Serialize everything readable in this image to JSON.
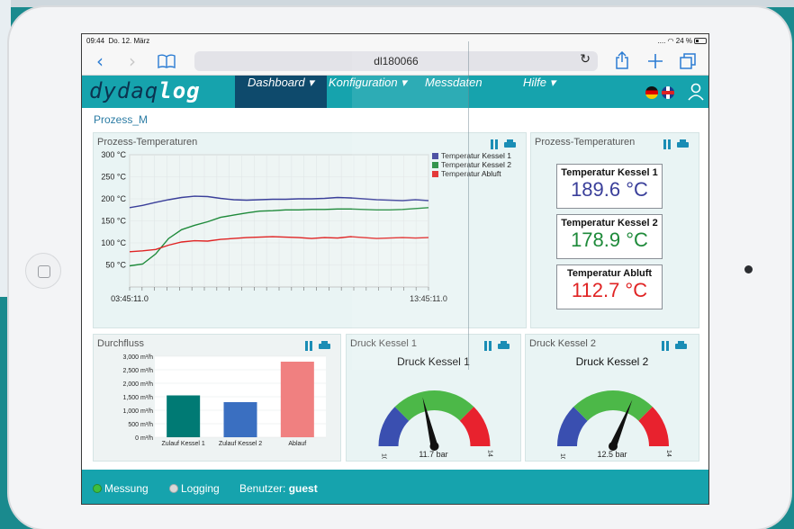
{
  "status": {
    "time": "09:44",
    "date": "Do. 12. März",
    "signal": "....",
    "battery": "24 %"
  },
  "browser": {
    "url": "dl180066",
    "icons": [
      "back-icon",
      "forward-icon",
      "bookmarks-icon",
      "reload-icon",
      "share-icon",
      "new-tab-icon",
      "tabs-icon"
    ]
  },
  "app": {
    "logo_plain": "dydaq",
    "logo_bold": "log",
    "nav": [
      {
        "label": "Dashboard ▾",
        "active": true
      },
      {
        "label": "Konfiguration ▾",
        "active": false
      },
      {
        "label": "Messdaten",
        "active": false
      },
      {
        "label": "Hilfe ▾",
        "active": false
      }
    ],
    "breadcrumb": "Prozess_M"
  },
  "panels": {
    "temps_chart_title": "Prozess-Temperaturen",
    "temps_tiles_title": "Prozess-Temperaturen",
    "flow_title": "Durchfluss",
    "gauge1_title": "Druck Kessel 1",
    "gauge2_title": "Druck Kessel 2"
  },
  "tiles": [
    {
      "label": "Temperatur Kessel 1",
      "value": "189.6 °C",
      "color": "#3a3f9a"
    },
    {
      "label": "Temperatur Kessel 2",
      "value": "178.9 °C",
      "color": "#1e8a3a"
    },
    {
      "label": "Temperatur Abluft",
      "value": "112.7 °C",
      "color": "#e02424"
    }
  ],
  "gauges": [
    {
      "title": "Druck Kessel 1",
      "value": 11.7,
      "value_text": "11.7 bar",
      "min": "10",
      "max": "14"
    },
    {
      "title": "Druck Kessel 2",
      "value": 12.5,
      "value_text": "12.5 bar",
      "min": "10",
      "max": "14"
    }
  ],
  "footer": {
    "messung": "Messung",
    "logging": "Logging",
    "benutzer_label": "Benutzer:",
    "benutzer": "guest"
  },
  "colors": {
    "accent": "#16a3ad",
    "nav_active": "#0e4a6c",
    "k1": "#3a3f9a",
    "k2": "#1e8a3a",
    "abluft": "#e02424"
  },
  "chart_data": [
    {
      "type": "line",
      "title": "Prozess-Temperaturen",
      "x_tick_labels": [
        "03:45:11.0",
        "13:45:11.0"
      ],
      "y_tick_labels": [
        "300 °C",
        "250 °C",
        "200 °C",
        "150 °C",
        "100 °C",
        "50 °C"
      ],
      "ylim": [
        0,
        300
      ],
      "legend": "top-right",
      "grid": true,
      "series": [
        {
          "name": "Temperatur Kessel 1",
          "color": "#3a3f9a",
          "values": [
            180,
            185,
            192,
            198,
            203,
            206,
            205,
            201,
            198,
            197,
            198,
            199,
            199,
            200,
            200,
            201,
            203,
            202,
            200,
            198,
            197,
            196,
            198,
            196
          ]
        },
        {
          "name": "Temperatur Kessel 2",
          "color": "#1e8a3a",
          "values": [
            48,
            52,
            75,
            110,
            130,
            140,
            148,
            158,
            163,
            168,
            172,
            173,
            175,
            175,
            176,
            176,
            177,
            177,
            176,
            175,
            175,
            176,
            178,
            180
          ]
        },
        {
          "name": "Temperatur Abluft",
          "color": "#e02424",
          "values": [
            80,
            82,
            85,
            95,
            102,
            105,
            104,
            108,
            110,
            112,
            113,
            114,
            113,
            112,
            110,
            112,
            111,
            114,
            112,
            110,
            111,
            112,
            111,
            112
          ]
        }
      ]
    },
    {
      "type": "bar",
      "title": "Durchfluss",
      "categories": [
        "Zulauf Kessel 1",
        "Zulauf Kessel 2",
        "Ablauf"
      ],
      "values": [
        1550,
        1300,
        2800
      ],
      "colors": [
        "#007a74",
        "#3a6fc1",
        "#f08080"
      ],
      "y_tick_labels": [
        "3,000 m³/h",
        "2,500 m³/h",
        "2,000 m³/h",
        "1,500 m³/h",
        "1,000 m³/h",
        "500 m³/h",
        "0 m³/h"
      ],
      "ylim": [
        0,
        3000
      ]
    }
  ]
}
